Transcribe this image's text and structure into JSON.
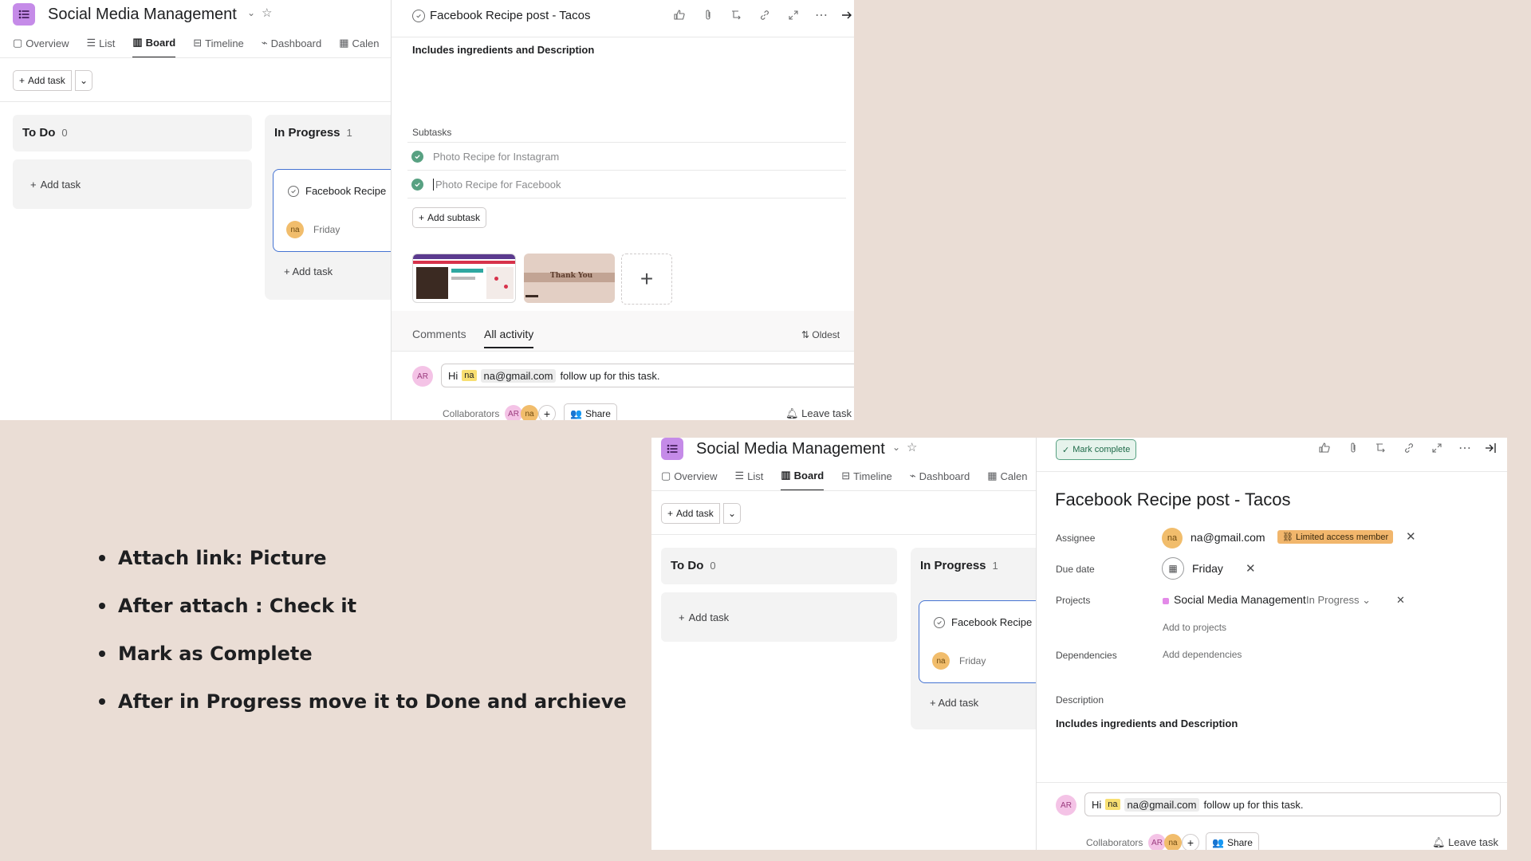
{
  "app": {
    "project_title": "Social Media Management",
    "tabs": [
      "Overview",
      "List",
      "Board",
      "Timeline",
      "Dashboard",
      "Calen"
    ],
    "add_task": "Add task"
  },
  "board": {
    "columns": [
      {
        "name": "To Do",
        "count": "0",
        "add_label": "Add task"
      },
      {
        "name": "In Progress",
        "count": "1",
        "add_label": "Add task"
      }
    ],
    "card": {
      "title": "Facebook Recipe",
      "assignee_initials": "na",
      "due": "Friday"
    }
  },
  "task_top": {
    "title": "Facebook Recipe post - Tacos",
    "description": "Includes ingredients and Description",
    "subtasks_label": "Subtasks",
    "subtasks": [
      "Photo Recipe for Instagram",
      "Photo Recipe for Facebook"
    ],
    "add_subtask": "Add subtask",
    "thumb_text": "Thank You",
    "tabs": [
      "Comments",
      "All activity"
    ],
    "sort_label": "Oldest"
  },
  "comment": {
    "author_initials": "AR",
    "greeting": "Hi",
    "mention_initials": "na",
    "mention_email": "na@gmail.com",
    "text": "follow up for this task."
  },
  "collab": {
    "label": "Collaborators",
    "share": "Share",
    "leave": "Leave task",
    "avatars": [
      "AR",
      "na"
    ]
  },
  "task_bottom": {
    "mark_complete": "Mark complete",
    "title": "Facebook Recipe post - Tacos",
    "fields": {
      "assignee_label": "Assignee",
      "assignee_initials": "na",
      "assignee_email": "na@gmail.com",
      "assignee_badge": "Limited access member",
      "due_label": "Due date",
      "due_value": "Friday",
      "projects_label": "Projects",
      "project_name": "Social Media Management",
      "project_section": "In Progress",
      "add_to_projects": "Add to projects",
      "dependencies_label": "Dependencies",
      "add_dependencies": "Add dependencies",
      "description_label": "Description",
      "description": "Includes ingredients and Description"
    }
  },
  "notes": [
    "Attach link: Picture",
    "After attach : Check it",
    "Mark as Complete",
    "After in Progress move it to Done and archieve"
  ],
  "colors": {
    "background": "#eaddd5",
    "accent_blue": "#4573d2",
    "avatar_na": "#f1bd6c",
    "avatar_ar": "#f4c3e6",
    "success": "#58a182",
    "app_icon": "#c58be8"
  }
}
